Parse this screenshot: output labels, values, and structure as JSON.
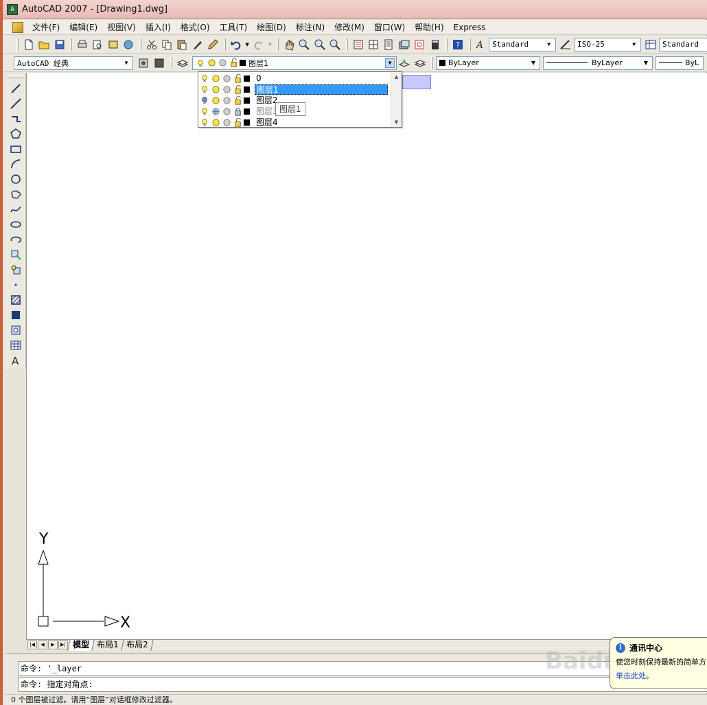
{
  "window": {
    "title": "AutoCAD 2007 - [Drawing1.dwg]",
    "icon_text": "A"
  },
  "menu": {
    "items": [
      "文件(F)",
      "编辑(E)",
      "视图(V)",
      "插入(I)",
      "格式(O)",
      "工具(T)",
      "绘图(D)",
      "标注(N)",
      "修改(M)",
      "窗口(W)",
      "帮助(H)",
      "Express"
    ]
  },
  "toolbar1": {
    "text_style": "Standard",
    "dim_style": "ISO-25",
    "table_style": "Standard"
  },
  "toolbar2": {
    "workspace": "AutoCAD 经典",
    "current_layer": "图层1",
    "color": "ByLayer",
    "linetype": "ByLayer",
    "lineweight": "ByL"
  },
  "layer_dropdown": {
    "items": [
      {
        "name": "0",
        "state": "normal"
      },
      {
        "name": "图层1",
        "state": "selected"
      },
      {
        "name": "图层2",
        "state": "normal"
      },
      {
        "name": "图层3",
        "state": "frozen"
      },
      {
        "name": "图层4",
        "state": "normal"
      }
    ],
    "tooltip": "图层1"
  },
  "ucs": {
    "y_label": "Y",
    "x_label": "X"
  },
  "tabs": {
    "model": "模型",
    "layout1": "布局1",
    "layout2": "布局2"
  },
  "command": {
    "line1": "命令: '_layer",
    "line2": "命令: 指定对角点:"
  },
  "status": {
    "text": "0 个图层被过滤。请用“图层”对话框修改过滤器。"
  },
  "balloon": {
    "title": "通讯中心",
    "text": "使您时刻保持最新的简单方",
    "link": "单击此处。"
  },
  "watermark": "Baidu 经验",
  "colors": {
    "selection": "#3399ff",
    "titlebar": "#e9b9b3",
    "canvas": "#ffffff"
  }
}
